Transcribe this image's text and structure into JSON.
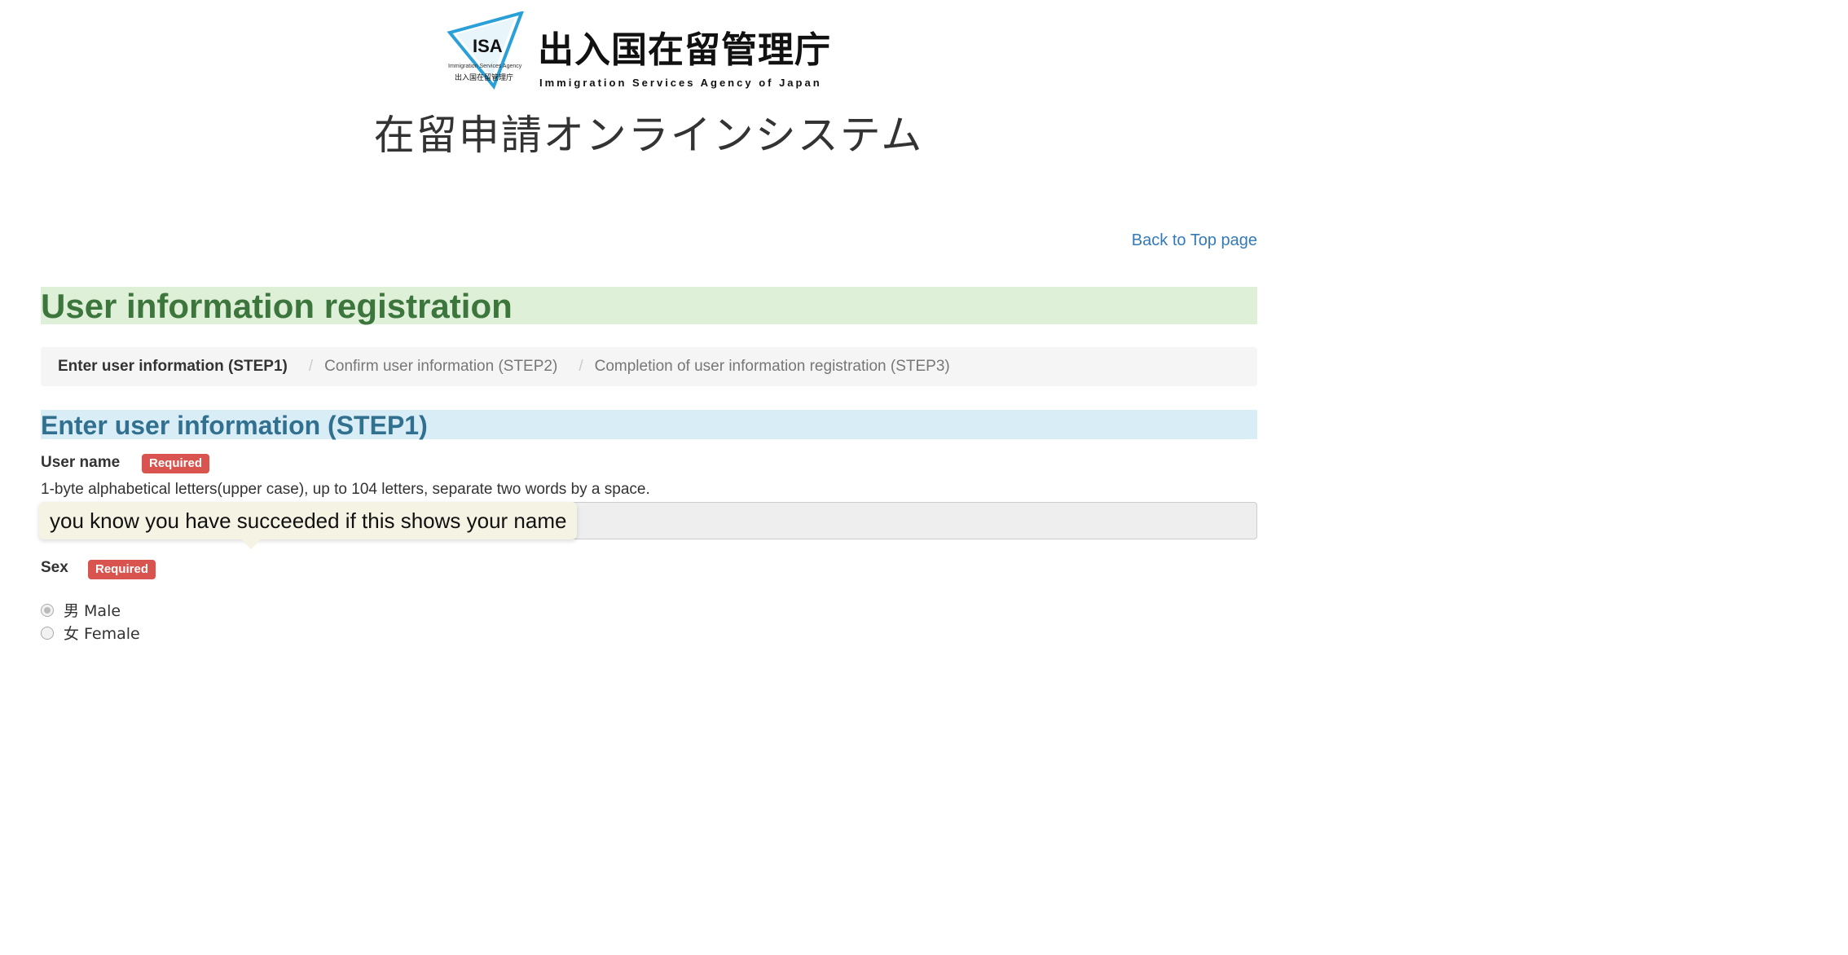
{
  "header": {
    "logo_mark": "ISA",
    "logo_mark_subtitle": "Immigration Services Agency",
    "logo_mark_jp": "出入国在留管理庁",
    "logo_title_jp": "出入国在留管理庁",
    "logo_title_en": "Immigration Services Agency of Japan",
    "system_title": "在留申請オンラインシステム",
    "logo_colors": {
      "triangle": "#2aa0d8",
      "text": "#111111"
    }
  },
  "nav": {
    "back_link": "Back to Top page"
  },
  "page": {
    "title": "User information registration"
  },
  "breadcrumb": {
    "items": [
      {
        "label": "Enter user information (STEP1)",
        "active": true
      },
      {
        "label": "Confirm user information (STEP2)",
        "active": false
      },
      {
        "label": "Completion of user information registration (STEP3)",
        "active": false
      }
    ],
    "separator": "/"
  },
  "step": {
    "title": "Enter user information (STEP1)"
  },
  "form": {
    "user_name": {
      "label": "User name",
      "badge": "Required",
      "help": "1-byte alphabetical letters(upper case), up to 104 letters, separate two words by a space.",
      "value": "",
      "tooltip": "you know you have succeeded if this shows your name"
    },
    "sex": {
      "label": "Sex",
      "badge": "Required",
      "options": [
        {
          "label": "男 Male",
          "checked": true
        },
        {
          "label": "女 Female",
          "checked": false
        }
      ]
    }
  },
  "colors": {
    "link": "#337ab7",
    "success_bg": "#dff0d8",
    "success_text": "#3c763d",
    "info_bg": "#d9edf7",
    "info_text": "#31708f",
    "required_badge": "#d9534f"
  }
}
